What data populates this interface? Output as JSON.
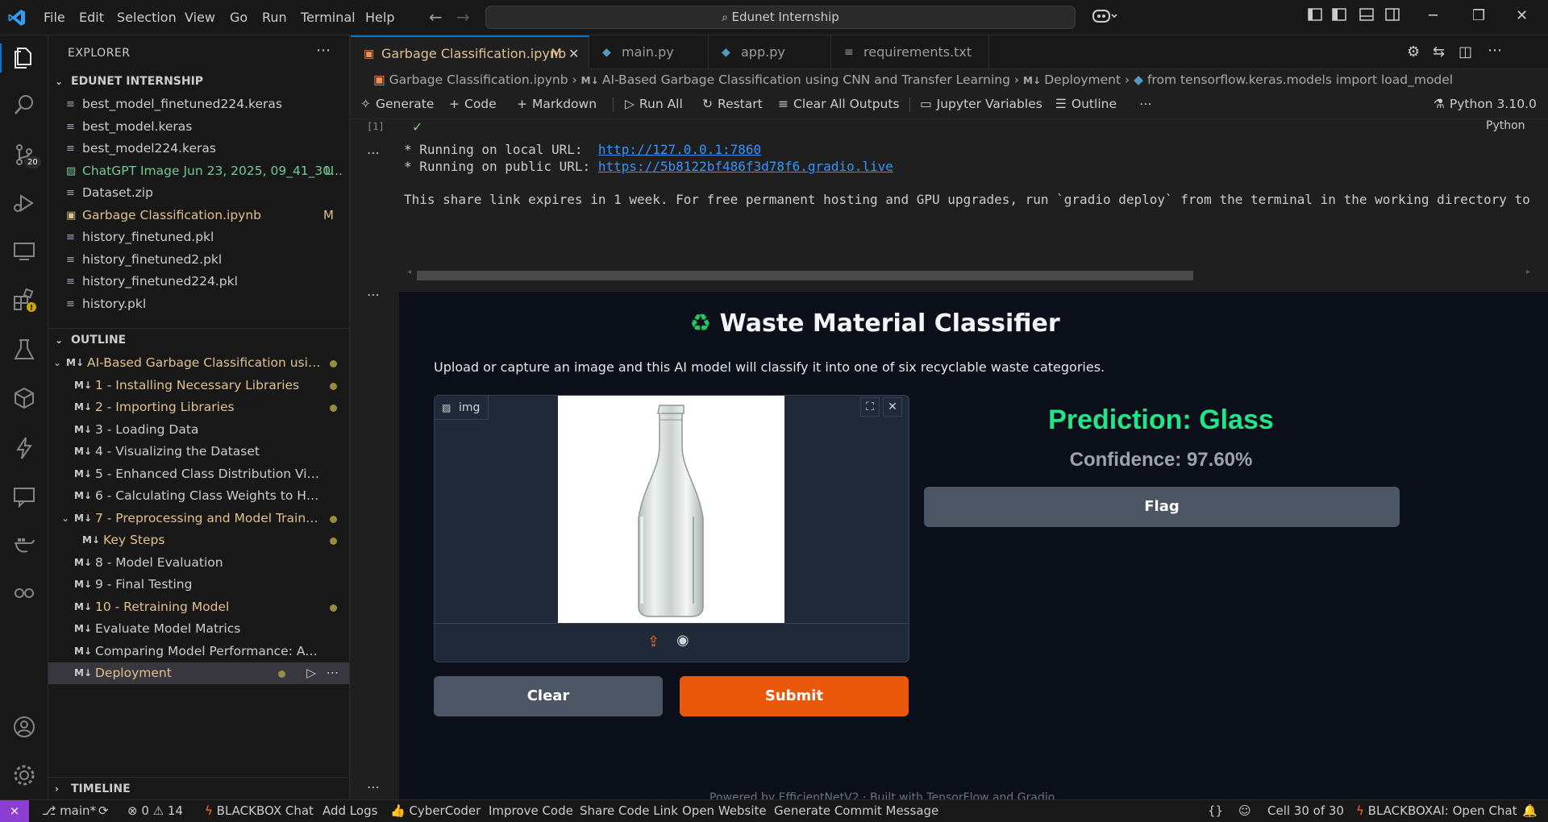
{
  "menu": [
    "File",
    "Edit",
    "Selection",
    "View",
    "Go",
    "Run",
    "Terminal",
    "Help"
  ],
  "command_center": "Edunet Internship",
  "sidebar": {
    "title": "EXPLORER",
    "workspace": "EDUNET INTERNSHIP",
    "files": [
      {
        "name": "best_model_finetuned224.keras",
        "badge": "",
        "status": ""
      },
      {
        "name": "best_model.keras",
        "badge": "",
        "status": ""
      },
      {
        "name": "best_model224.keras",
        "badge": "",
        "status": ""
      },
      {
        "name": "ChatGPT Image Jun 23, 2025, 09_41_30...",
        "badge": "U",
        "status": "untracked"
      },
      {
        "name": "Dataset.zip",
        "badge": "",
        "status": ""
      },
      {
        "name": "Garbage Classification.ipynb",
        "badge": "M",
        "status": "modified"
      },
      {
        "name": "history_finetuned.pkl",
        "badge": "",
        "status": ""
      },
      {
        "name": "history_finetuned2.pkl",
        "badge": "",
        "status": ""
      },
      {
        "name": "history_finetuned224.pkl",
        "badge": "",
        "status": ""
      },
      {
        "name": "history.pkl",
        "badge": "",
        "status": ""
      }
    ],
    "outline_title": "OUTLINE",
    "outline": [
      {
        "label": "AI-Based Garbage Classification usin...",
        "level": 0,
        "modified": true,
        "chevron": "v"
      },
      {
        "label": "1 - Installing Necessary Libraries",
        "level": 1,
        "modified": true,
        "chevron": ""
      },
      {
        "label": "2 - Importing Libraries",
        "level": 1,
        "modified": true,
        "chevron": ""
      },
      {
        "label": "3 - Loading Data",
        "level": 1,
        "modified": false,
        "chevron": ""
      },
      {
        "label": "4 - Visualizing the Dataset",
        "level": 1,
        "modified": false,
        "chevron": ""
      },
      {
        "label": "5 - Enhanced Class Distribution Visua...",
        "level": 1,
        "modified": false,
        "chevron": ""
      },
      {
        "label": "6 - Calculating Class Weights to Han...",
        "level": 1,
        "modified": false,
        "chevron": ""
      },
      {
        "label": "7 - Preprocessing and Model Training",
        "level": 1,
        "modified": true,
        "chevron": "v"
      },
      {
        "label": "Key Steps",
        "level": 2,
        "modified": true,
        "chevron": ""
      },
      {
        "label": "8 - Model Evaluation",
        "level": 1,
        "modified": false,
        "chevron": ""
      },
      {
        "label": "9 - Final Testing",
        "level": 1,
        "modified": false,
        "chevron": ""
      },
      {
        "label": "10 - Retraining Model",
        "level": 1,
        "modified": true,
        "chevron": ""
      },
      {
        "label": "Evaluate Model Matrics",
        "level": 1,
        "modified": false,
        "chevron": ""
      },
      {
        "label": "Comparing Model Performance: Accu...",
        "level": 1,
        "modified": false,
        "chevron": ""
      },
      {
        "label": "Deployment",
        "level": 1,
        "modified": true,
        "chevron": "",
        "selected": true
      }
    ],
    "timeline_title": "TIMELINE"
  },
  "tabs": [
    {
      "label": "Garbage Classification.ipynb",
      "badge": "M",
      "active": true
    },
    {
      "label": "main.py",
      "active": false
    },
    {
      "label": "app.py",
      "active": false
    },
    {
      "label": "requirements.txt",
      "active": false
    }
  ],
  "breadcrumb": [
    "Garbage Classification.ipynb",
    "AI-Based Garbage Classification using CNN and Transfer Learning",
    "Deployment",
    "from tensorflow.keras.models import load_model"
  ],
  "toolbar": {
    "generate": "Generate",
    "code": "Code",
    "markdown": "Markdown",
    "run_all": "Run All",
    "restart": "Restart",
    "clear_outputs": "Clear All Outputs",
    "variables": "Jupyter Variables",
    "outline": "Outline",
    "kernel": "Python 3.10.0"
  },
  "cell": {
    "exec_count": "[1]",
    "lang": "Python",
    "out_line1": "* Running on local URL:  ",
    "local_url": "http://127.0.0.1:7860",
    "out_line2": "* Running on public URL: ",
    "public_url": "https://5b8122bf486f3d78f6.gradio.live",
    "share_note": "This share link expires in 1 week. For free permanent hosting and GPU upgrades, run `gradio deploy` from the terminal in the working directory to"
  },
  "gradio": {
    "title": "Waste Material Classifier",
    "emoji": "♻️",
    "description": "Upload or capture an image and this AI model will classify it into one of six recyclable waste categories.",
    "image_label": "img",
    "prediction": "Prediction: Glass",
    "confidence": "Confidence: 97.60%",
    "flag_label": "Flag",
    "clear_label": "Clear",
    "submit_label": "Submit",
    "footer_hint": "Powered by EfficientNetV2 · Built with TensorFlow and Gradio"
  },
  "status": {
    "branch": "main*",
    "errors": "0",
    "warnings": "14",
    "items": [
      "BLACKBOX Chat",
      "Add Logs",
      "CyberCoder",
      "Improve Code",
      "Share Code Link",
      "Open Website",
      "Generate Commit Message"
    ],
    "cell_pos": "Cell 30 of 30",
    "blackbox_open": "BLACKBOXAI: Open Chat"
  },
  "activity_badges": {
    "scm": "20"
  }
}
